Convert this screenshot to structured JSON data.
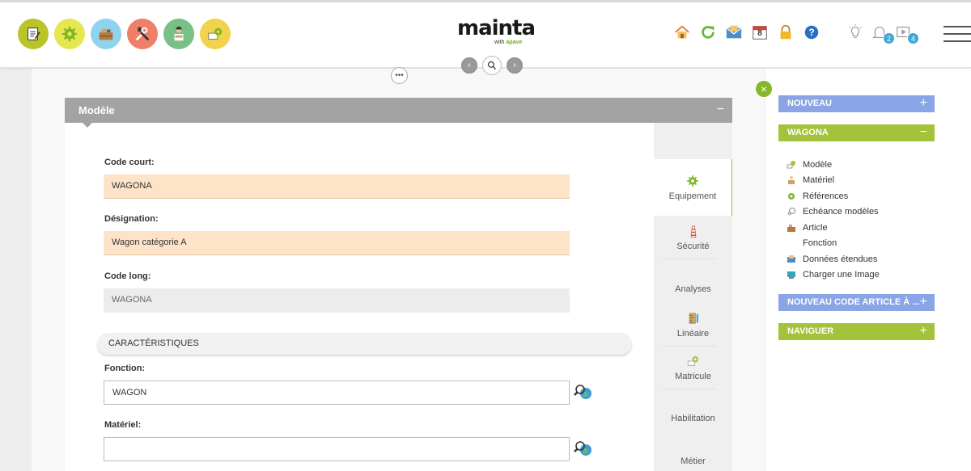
{
  "app": {
    "logo_text": "mainta",
    "logo_sub_prefix": "with",
    "logo_sub_brand": "apave"
  },
  "app_icons": [
    {
      "name": "notes-app-icon",
      "color": "#b9c42a"
    },
    {
      "name": "gear-app-icon",
      "color": "#e4e84e"
    },
    {
      "name": "warehouse-app-icon",
      "color": "#8fd3ee"
    },
    {
      "name": "tools-app-icon",
      "color": "#f07f68"
    },
    {
      "name": "technician-app-icon",
      "color": "#79c087"
    },
    {
      "name": "settings-app-icon",
      "color": "#f3d24b"
    }
  ],
  "toolbar": {
    "calendar_day": "8",
    "notifications_count": "2",
    "videos_count": "4",
    "more_label": "•••",
    "close_label": "×"
  },
  "model": {
    "title": "Modèle",
    "collapse_sign": "−",
    "fields": {
      "code_court_label": "Code court:",
      "code_court_value": "WAGONA",
      "designation_label": "Désignation:",
      "designation_value": "Wagon catégorie A",
      "code_long_label": "Code long:",
      "code_long_value": "WAGONA",
      "section_title": "CARACTÉRISTIQUES",
      "fonction_label": "Fonction:",
      "fonction_value": "WAGON",
      "materiel_label": "Matériel:",
      "materiel_value": ""
    },
    "tabs": [
      "Equipement",
      "Sécurité",
      "Analyses",
      "Linéaire",
      "Matricule",
      "Habilitation",
      "Métier"
    ]
  },
  "sidebar": {
    "nouveau": {
      "label": "NOUVEAU",
      "sign": "+"
    },
    "wagona": {
      "label": "WAGONA",
      "sign": "−"
    },
    "items": [
      "Modèle",
      "Matériel",
      "Références",
      "Echéance modèles",
      "Article",
      "Fonction",
      "Données étendues",
      "Charger une Image"
    ],
    "nouveau_code": {
      "label": "NOUVEAU CODE ARTICLE À ...",
      "sign": "+"
    },
    "naviguer": {
      "label": "NAVIGUER",
      "sign": "+"
    }
  },
  "colors": {
    "accent_green": "#a4c23a",
    "accent_blue": "#8aa5e6",
    "header_grey": "#a3a3a3",
    "orange_input": "#fde3c8"
  }
}
